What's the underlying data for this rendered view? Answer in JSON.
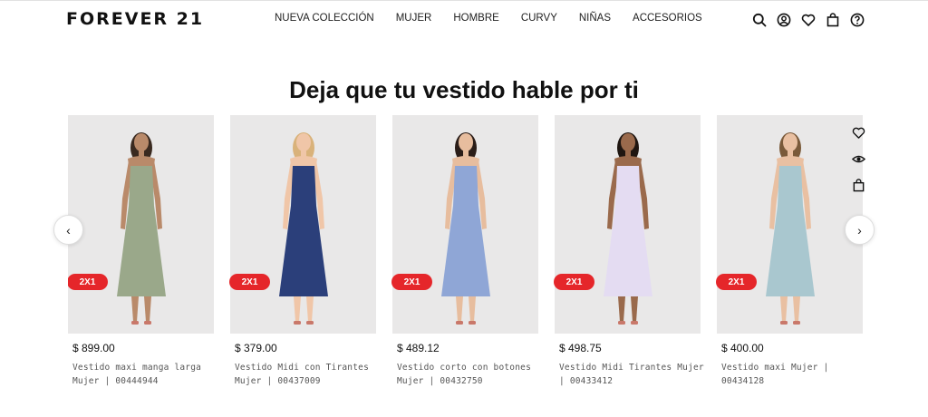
{
  "brand": {
    "logo": "FOREVER 21"
  },
  "nav": {
    "items": [
      {
        "label": "NUEVA COLECCIÓN"
      },
      {
        "label": "MUJER"
      },
      {
        "label": "HOMBRE"
      },
      {
        "label": "CURVY"
      },
      {
        "label": "NIÑAS"
      },
      {
        "label": "ACCESORIOS"
      }
    ]
  },
  "header_icons": [
    "search-icon",
    "account-icon",
    "wishlist-icon",
    "bag-icon",
    "help-icon"
  ],
  "section": {
    "title": "Deja que tu vestido hable por ti"
  },
  "carousel": {
    "prev": "‹",
    "next": "›",
    "products": [
      {
        "badge": "2X1",
        "price": "$ 899.00",
        "description": "Vestido maxi manga larga Mujer | 00444944",
        "dress_color": "#9aa88a",
        "skin": "#b98a6a",
        "hair": "#3a2a20"
      },
      {
        "badge": "2X1",
        "price": "$ 379.00",
        "description": "Vestido Midi con Tirantes Mujer | 00437009",
        "dress_color": "#2b3f7a",
        "skin": "#f0c6a8",
        "hair": "#d9b27a"
      },
      {
        "badge": "2X1",
        "price": "$ 489.12",
        "description": "Vestido corto con botones Mujer | 00432750",
        "dress_color": "#8fa6d6",
        "skin": "#e7bd9e",
        "hair": "#2a1d18"
      },
      {
        "badge": "2X1",
        "price": "$ 498.75",
        "description": "Vestido Midi Tirantes Mujer | 00433412",
        "dress_color": "#e4dcf2",
        "skin": "#9a6a4c",
        "hair": "#1f1611"
      },
      {
        "badge": "2X1",
        "price": "$ 400.00",
        "description": "Vestido maxi Mujer | 00434128",
        "dress_color": "#a9c7cf",
        "skin": "#e9c0a2",
        "hair": "#7a5a3a"
      }
    ]
  },
  "product_actions": [
    "wishlist-icon",
    "quick-view-icon",
    "add-to-bag-icon"
  ],
  "colors": {
    "badge": "#e5262a",
    "image_bg": "#e9e8e8"
  }
}
